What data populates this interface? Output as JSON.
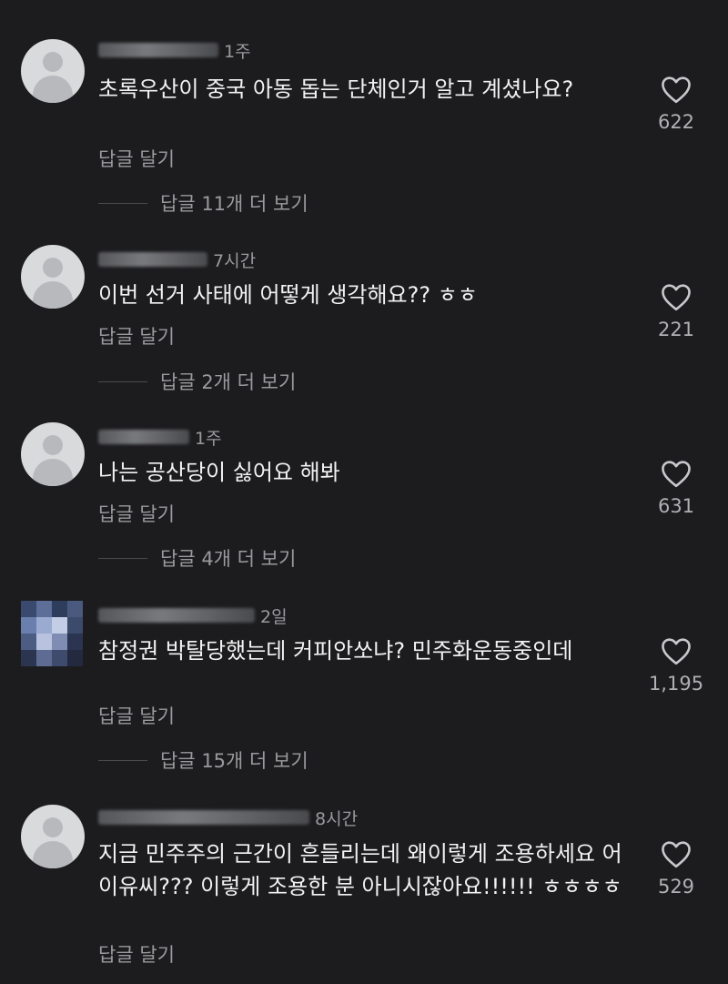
{
  "comments": [
    {
      "time": "1주",
      "text": "초록우산이 중국 아동 돕는 단체인거 알고 계셨나요?",
      "reply_label": "답글 달기",
      "view_replies": "답글 11개 더 보기",
      "likes": "622"
    },
    {
      "time": "7시간",
      "text": "이번 선거 사태에 어떻게 생각해요?? ㅎㅎ",
      "reply_label": "답글 달기",
      "view_replies": "답글 2개 더 보기",
      "likes": "221"
    },
    {
      "time": "1주",
      "text": "나는 공산당이 싫어요 해봐",
      "reply_label": "답글 달기",
      "view_replies": "답글 4개 더 보기",
      "likes": "631"
    },
    {
      "time": "2일",
      "text": "참정권 박탈당했는데 커피안쏘냐? 민주화운동중인데",
      "reply_label": "답글 달기",
      "view_replies": "답글 15개 더 보기",
      "likes": "1,195"
    },
    {
      "time": "8시간",
      "text": "지금 민주주의 근간이 흔들리는데 왜이렇게 조용하세요 어이유씨??? 이렇게 조용한 분 아니시잖아요!!!!!! ㅎㅎㅎㅎ",
      "reply_label": "답글 달기",
      "view_replies": "",
      "likes": "529"
    }
  ]
}
